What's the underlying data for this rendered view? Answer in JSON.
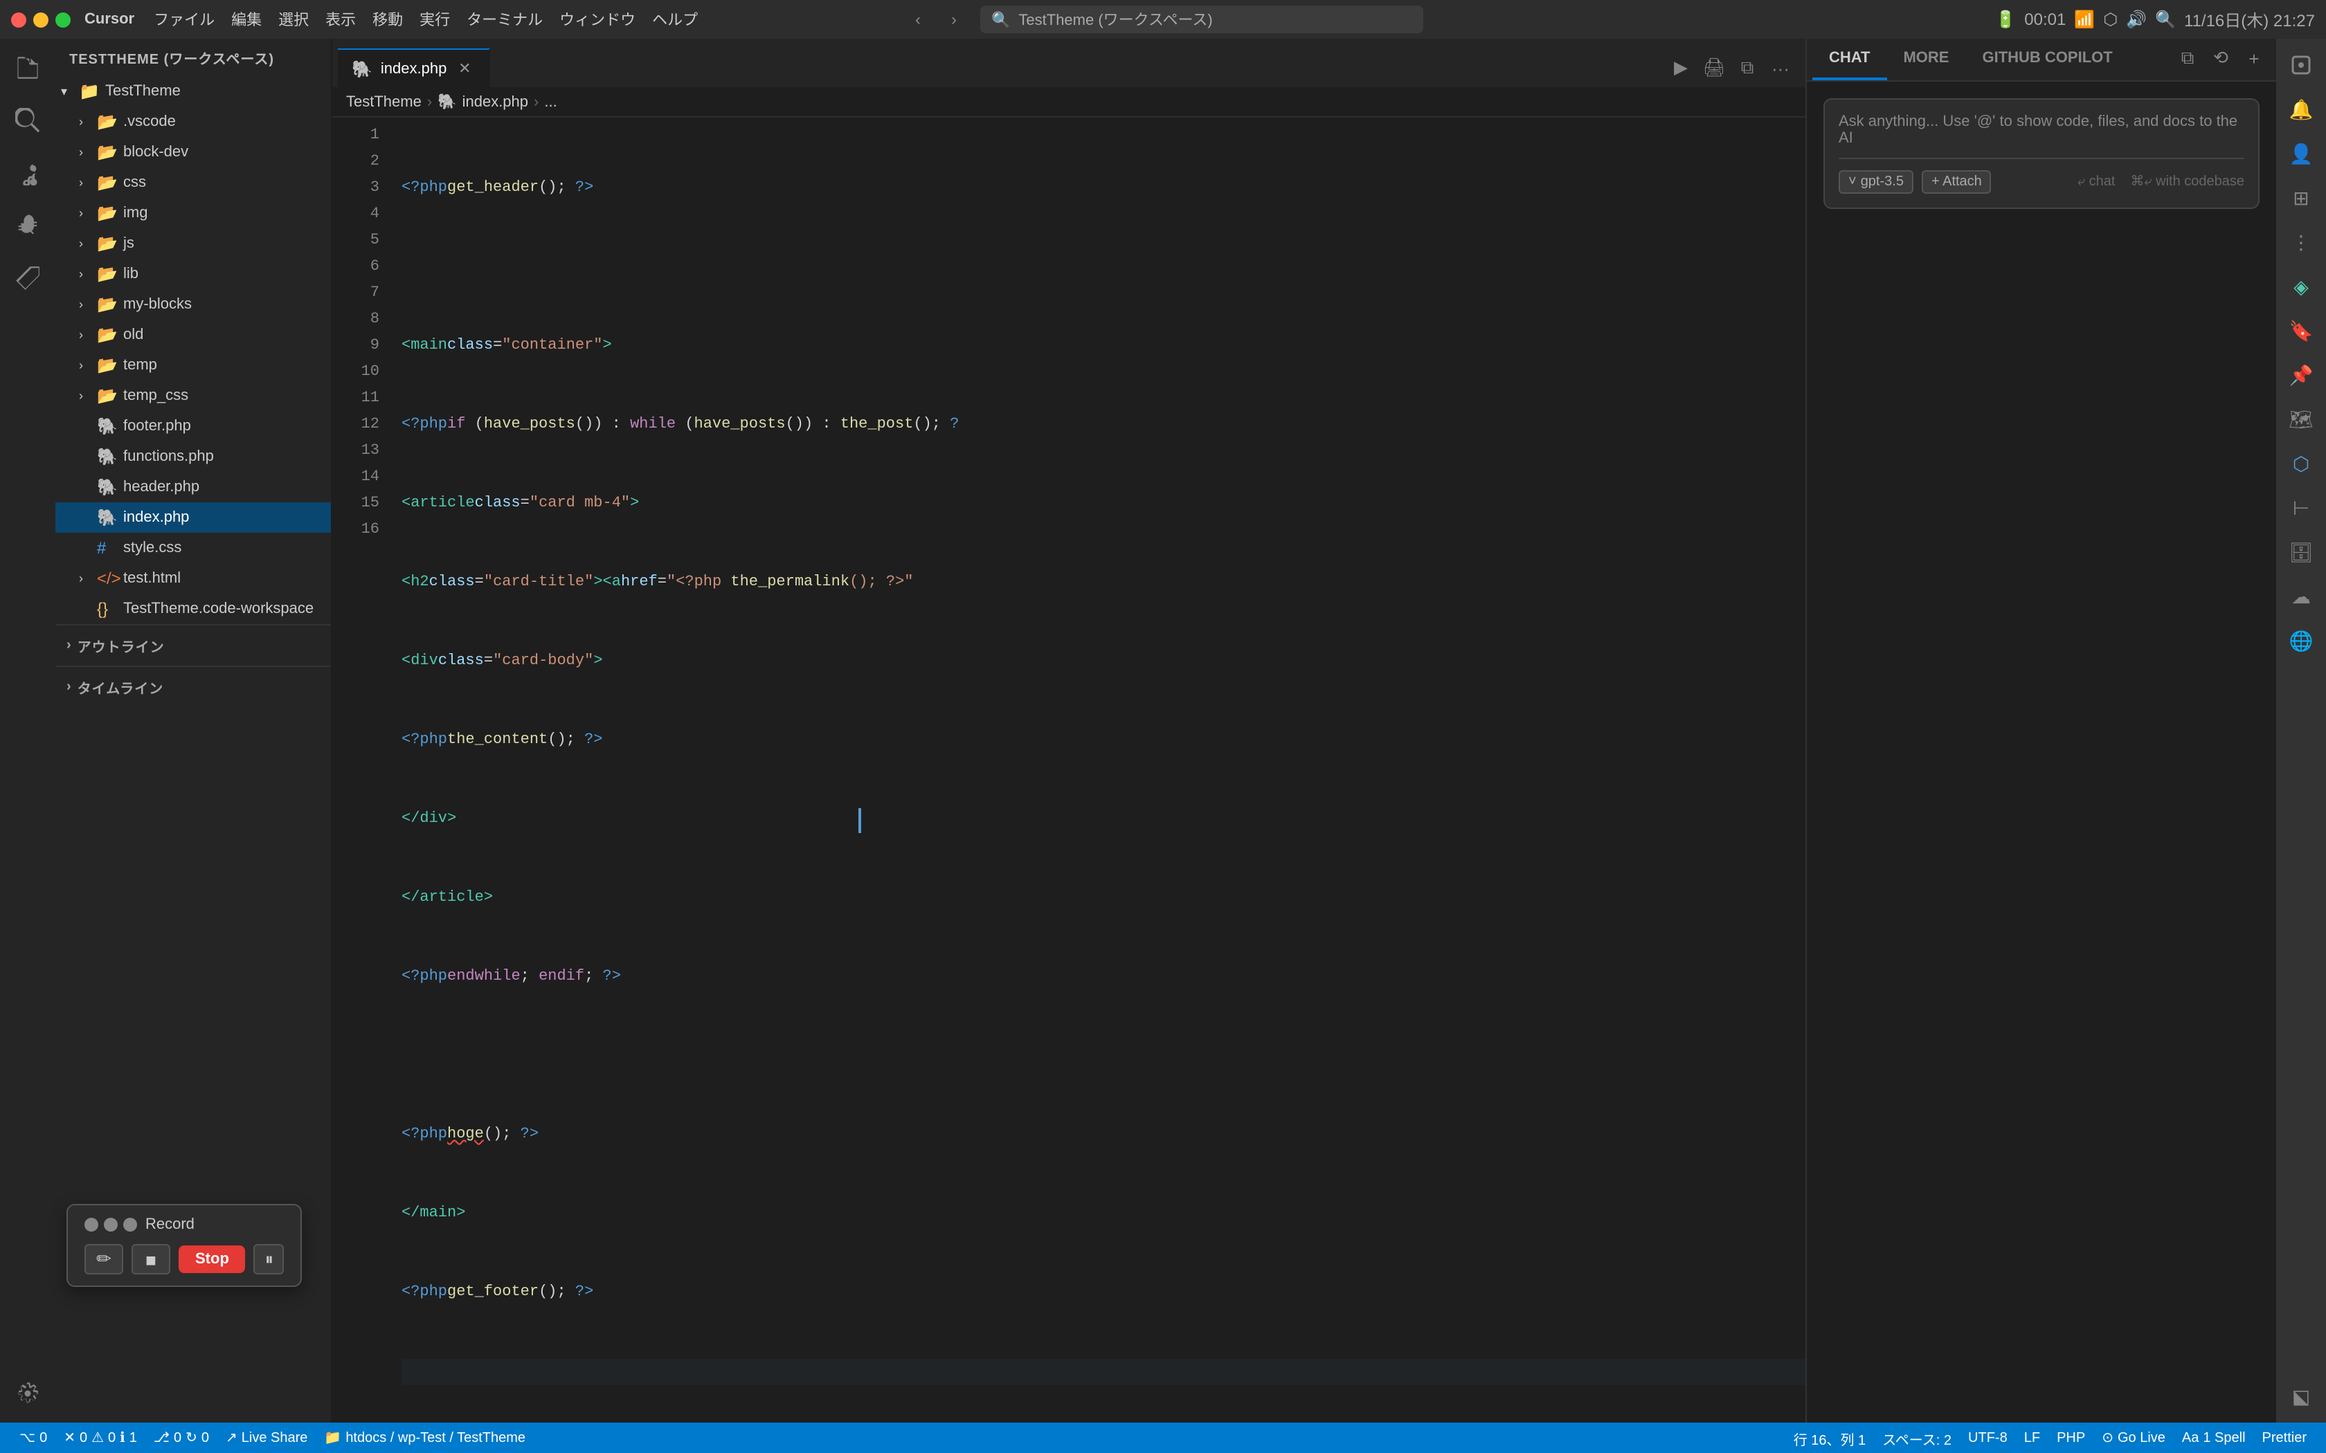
{
  "app": {
    "name": "Cursor",
    "title": "TestTheme (ワークスペース)"
  },
  "titlebar": {
    "menu_items": [
      "ファイル",
      "編集",
      "選択",
      "表示",
      "移動",
      "実行",
      "ターミナル",
      "ウィンドウ",
      "ヘルプ"
    ],
    "search_text": "TestTheme (ワークスペース)",
    "time": "11/16日(木) 21:27",
    "battery_time": "00:01"
  },
  "sidebar": {
    "workspace_label": "TESTTHEME (ワークスペース)",
    "root_folder": "TestTheme",
    "items": [
      {
        "id": "vscode",
        "label": ".vscode",
        "type": "folder",
        "indent": 1
      },
      {
        "id": "block-dev",
        "label": "block-dev",
        "type": "folder",
        "indent": 1
      },
      {
        "id": "css",
        "label": "css",
        "type": "folder",
        "indent": 1
      },
      {
        "id": "img",
        "label": "img",
        "type": "folder",
        "indent": 1
      },
      {
        "id": "js",
        "label": "js",
        "type": "folder",
        "indent": 1
      },
      {
        "id": "lib",
        "label": "lib",
        "type": "folder",
        "indent": 1
      },
      {
        "id": "my-blocks",
        "label": "my-blocks",
        "type": "folder",
        "indent": 1
      },
      {
        "id": "old",
        "label": "old",
        "type": "folder",
        "indent": 1
      },
      {
        "id": "temp",
        "label": "temp",
        "type": "folder",
        "indent": 1
      },
      {
        "id": "temp_css",
        "label": "temp_css",
        "type": "folder",
        "indent": 1
      },
      {
        "id": "footer.php",
        "label": "footer.php",
        "type": "php",
        "indent": 1
      },
      {
        "id": "functions.php",
        "label": "functions.php",
        "type": "php",
        "indent": 1
      },
      {
        "id": "header.php",
        "label": "header.php",
        "type": "php",
        "indent": 1
      },
      {
        "id": "index.php",
        "label": "index.php",
        "type": "php",
        "indent": 1,
        "active": true
      },
      {
        "id": "style.css",
        "label": "style.css",
        "type": "css",
        "indent": 1
      },
      {
        "id": "test.html",
        "label": "test.html",
        "type": "html",
        "indent": 1
      },
      {
        "id": "workspace",
        "label": "TestTheme.code-workspace",
        "type": "json",
        "indent": 1
      }
    ]
  },
  "editor": {
    "tab_label": "index.php",
    "breadcrumb": [
      "TestTheme",
      "index.php",
      "..."
    ],
    "lines": [
      {
        "num": 1,
        "code": "<?php get_header(); ?>"
      },
      {
        "num": 2,
        "code": ""
      },
      {
        "num": 3,
        "code": "<main class=\"container\">"
      },
      {
        "num": 4,
        "code": "    <?php if (have_posts()) : while (have_posts()) : the_post(); ?"
      },
      {
        "num": 5,
        "code": "        <article class=\"card mb-4\">"
      },
      {
        "num": 6,
        "code": "            <h2 class=\"card-title\"><a href=\"<?php the_permalink(); ?>\""
      },
      {
        "num": 7,
        "code": "            <div class=\"card-body\">"
      },
      {
        "num": 8,
        "code": "                <?php the_content(); ?>"
      },
      {
        "num": 9,
        "code": "            </div>"
      },
      {
        "num": 10,
        "code": "        </article>"
      },
      {
        "num": 11,
        "code": "    <?php endwhile; endif; ?>"
      },
      {
        "num": 12,
        "code": ""
      },
      {
        "num": 13,
        "code": "    <?php hoge(); ?>"
      },
      {
        "num": 14,
        "code": "</main>"
      },
      {
        "num": 15,
        "code": "<?php get_footer(); ?>"
      },
      {
        "num": 16,
        "code": ""
      }
    ],
    "cursor_line": 16,
    "cursor_col": 1
  },
  "chat": {
    "tabs": [
      "CHAT",
      "MORE",
      "GITHUB COPILOT"
    ],
    "active_tab": "CHAT",
    "placeholder": "Ask anything... Use '@' to show code, files, and docs to the AI",
    "model": "gpt-3.5",
    "attach_label": "+ Attach",
    "chat_label": "⤶ chat",
    "codebase_label": "⌘⤶ with codebase"
  },
  "record_widget": {
    "label": "Record",
    "stop_label": "Stop",
    "pause_symbol": "⏸"
  },
  "outline": {
    "label": "アウトライン",
    "timeline_label": "タイムライン"
  },
  "statusbar": {
    "branch_icon": "⎇",
    "errors": "0",
    "warnings": "0",
    "info": "1",
    "live_share": "Live Share",
    "path": "htdocs / wp-Test / TestTheme",
    "line_col": "行 16、列 1",
    "spaces": "スペース: 2",
    "encoding": "UTF-8",
    "line_ending": "LF",
    "language": "PHP",
    "go_live": "Go Live",
    "spell": "1 Spell",
    "prettier": "Prettier"
  }
}
